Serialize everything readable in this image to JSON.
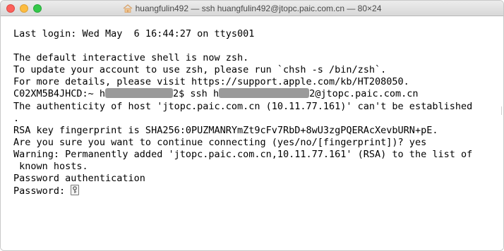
{
  "window": {
    "title": "huangfulin492 — ssh huangfulin492@jtopc.paic.com.cn — 80×24"
  },
  "terminal": {
    "line1": "Last login: Wed May  6 16:44:27 on ttys001",
    "line2": "",
    "line3": "The default interactive shell is now zsh.",
    "line4": "To update your account to use zsh, please run `chsh -s /bin/zsh`.",
    "line5": "For more details, please visit https://support.apple.com/kb/HT208050.",
    "line6_prompt": "C02XM5B4JHCD:~ h",
    "line6_mid": "2$ ssh h",
    "line6_end": "2@jtopc.paic.com.cn",
    "line7": "The authenticity of host 'jtopc.paic.com.cn (10.11.77.161)' can't be established",
    "line8": ".",
    "line9": "RSA key fingerprint is SHA256:0PUZMANRYmZt9cFv7RbD+8wU3zgPQERAcXevbURN+pE.",
    "line10": "Are you sure you want to continue connecting (yes/no/[fingerprint])? yes",
    "line11": "Warning: Permanently added 'jtopc.paic.com.cn,10.11.77.161' (RSA) to the list of",
    "line12": " known hosts.",
    "line13": "Password authentication",
    "line14": "Password: "
  }
}
